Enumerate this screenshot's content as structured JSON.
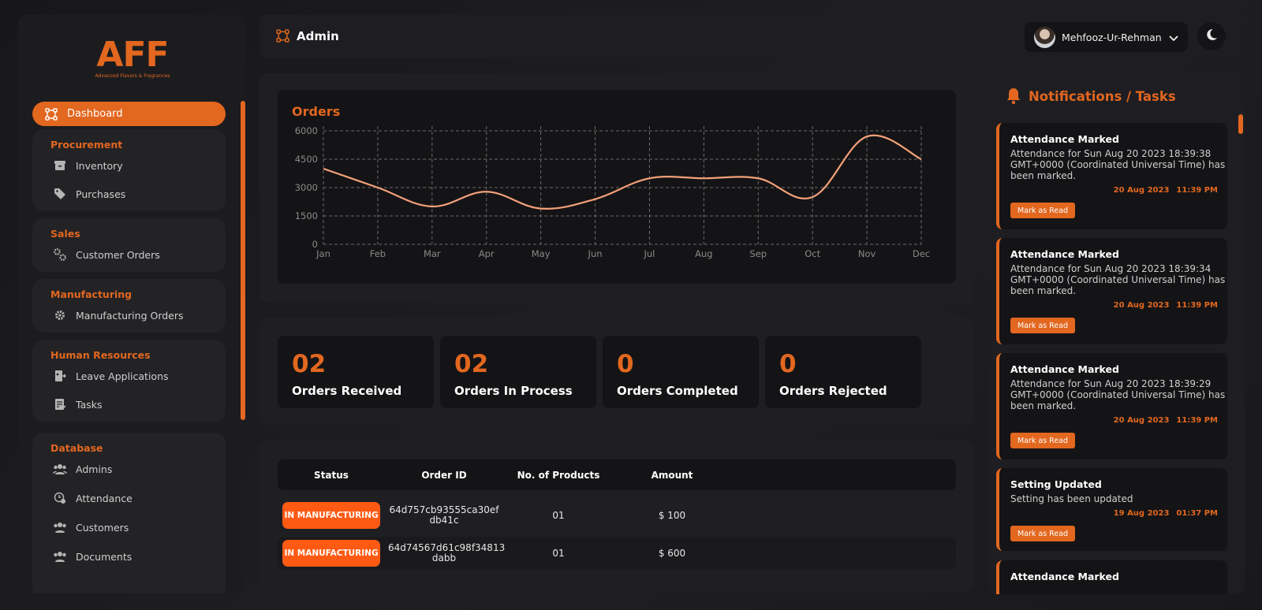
{
  "brand": {
    "logo_text": "AFF",
    "logo_subtitle": "Advanced Flavors & Fragrances"
  },
  "sidebar": {
    "active_item": {
      "label": "Dashboard",
      "icon": "dashboard-icon"
    },
    "groups": [
      {
        "title": "Procurement",
        "items": [
          {
            "label": "Inventory",
            "icon": "archive-box-icon"
          },
          {
            "label": "Purchases",
            "icon": "tag-icon"
          }
        ]
      },
      {
        "title": "Sales",
        "items": [
          {
            "label": "Customer Orders",
            "icon": "gears-icon"
          }
        ]
      },
      {
        "title": "Manufacturing",
        "items": [
          {
            "label": "Manufacturing Orders",
            "icon": "gear-icon"
          }
        ]
      },
      {
        "title": "Human Resources",
        "items": [
          {
            "label": "Leave Applications",
            "icon": "door-exit-icon"
          },
          {
            "label": "Tasks",
            "icon": "task-list-icon"
          }
        ]
      },
      {
        "title": "Database",
        "items": [
          {
            "label": "Admins",
            "icon": "users-icon"
          },
          {
            "label": "Attendance",
            "icon": "clock-user-icon"
          },
          {
            "label": "Customers",
            "icon": "users-icon"
          },
          {
            "label": "Documents",
            "icon": "users-icon"
          }
        ]
      }
    ]
  },
  "header": {
    "title": "Admin",
    "user_name": "Mehfooz-Ur-Rehman",
    "theme_icon": "moon-icon"
  },
  "chart_data": {
    "type": "line",
    "title": "Orders",
    "categories": [
      "Jan",
      "Feb",
      "Mar",
      "Apr",
      "May",
      "Jun",
      "Jul",
      "Aug",
      "Sep",
      "Oct",
      "Nov",
      "Dec"
    ],
    "series": [
      {
        "values": [
          4000,
          3000,
          2000,
          2780,
          1890,
          2390,
          3490,
          3490,
          3490,
          2500,
          5700,
          4500
        ]
      }
    ],
    "y_ticks": [
      0,
      1500,
      3000,
      4500,
      6000
    ],
    "ylim": [
      0,
      6000
    ],
    "grid": true,
    "colors": {
      "line": "#f5a07a",
      "grid": "#6a6a6a",
      "axis_text": "#8a8a8a"
    }
  },
  "stats": [
    {
      "value": "02",
      "label": "Orders Received"
    },
    {
      "value": "02",
      "label": "Orders In Process"
    },
    {
      "value": "0",
      "label": "Orders Completed"
    },
    {
      "value": "0",
      "label": "Orders Rejected"
    }
  ],
  "orders_table": {
    "columns": [
      "Status",
      "Order ID",
      "No. of Products",
      "Amount"
    ],
    "rows": [
      {
        "status": "IN MANUFACTURING",
        "order_id_line1": "64d757cb93555ca30ef",
        "order_id_line2": "db41c",
        "products": "01",
        "amount": "$ 100"
      },
      {
        "status": "IN MANUFACTURING",
        "order_id_line1": "64d74567d61c98f34813",
        "order_id_line2": "dabb",
        "products": "01",
        "amount": "$ 600"
      }
    ]
  },
  "notifications": {
    "title": "Notifications / Tasks",
    "action_label": "Mark as Read",
    "items": [
      {
        "title": "Attendance Marked",
        "body": "Attendance for Sun Aug 20 2023 18:39:38 GMT+0000 (Coordinated Universal Time) has been marked.",
        "date": "20 Aug 2023",
        "time": "11:39 PM"
      },
      {
        "title": "Attendance Marked",
        "body": "Attendance for Sun Aug 20 2023 18:39:34 GMT+0000 (Coordinated Universal Time) has been marked.",
        "date": "20 Aug 2023",
        "time": "11:39 PM"
      },
      {
        "title": "Attendance Marked",
        "body": "Attendance for Sun Aug 20 2023 18:39:29 GMT+0000 (Coordinated Universal Time) has been marked.",
        "date": "20 Aug 2023",
        "time": "11:39 PM"
      },
      {
        "title": "Setting Updated",
        "body": "Setting has been updated",
        "date": "19 Aug 2023",
        "time": "01:37 PM"
      },
      {
        "title": "Attendance Marked"
      }
    ]
  },
  "colors": {
    "accent": "#e2671f",
    "status_pill": "#ff5a14",
    "background": "#1a1a1e",
    "card": "#141416"
  }
}
